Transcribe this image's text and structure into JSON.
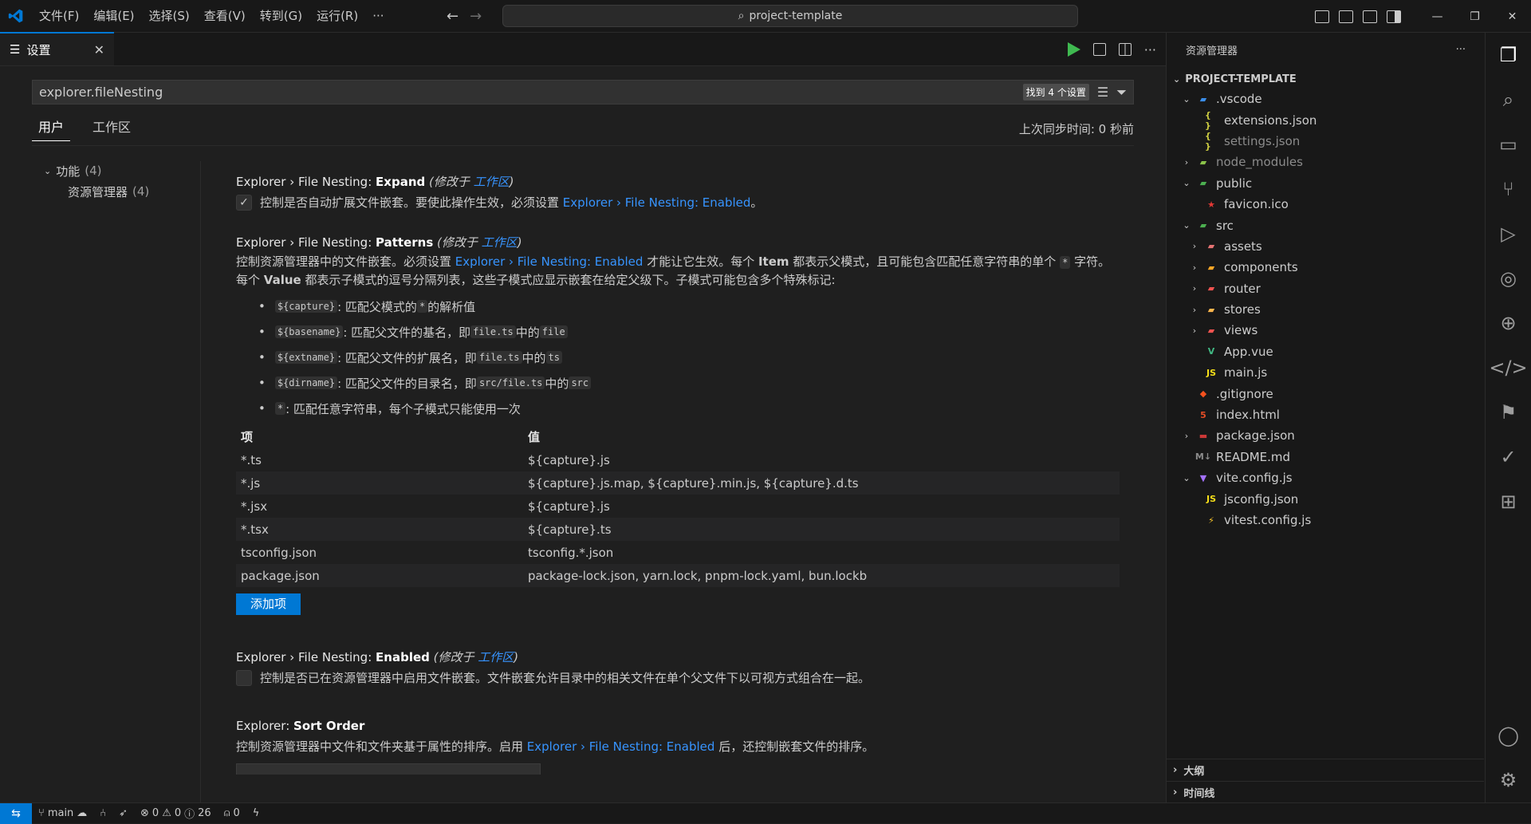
{
  "titlebar": {
    "menus": [
      "文件(F)",
      "编辑(E)",
      "选择(S)",
      "查看(V)",
      "转到(G)",
      "运行(R)",
      "···"
    ],
    "command_center": "project-template"
  },
  "editor": {
    "tab_label": "设置",
    "search_value": "explorer.fileNesting",
    "found_badge": "找到 4 个设置",
    "scope_tabs": [
      "用户",
      "工作区"
    ],
    "sync_time": "上次同步时间: 0 秒前",
    "toc": {
      "group": "功能",
      "group_count": "(4)",
      "item": "资源管理器",
      "item_count": "(4)"
    },
    "settings": {
      "expand": {
        "prefix": "Explorer › File Nesting: ",
        "name": "Expand",
        "modified": "(修改于 ",
        "workspace": "工作区",
        "close": ")",
        "desc_a": "控制是否自动扩展文件嵌套。要使此操作生效，必须设置 ",
        "desc_link": "Explorer › File Nesting: Enabled",
        "desc_b": "。"
      },
      "patterns": {
        "prefix": "Explorer › File Nesting: ",
        "name": "Patterns",
        "modified": "(修改于 ",
        "workspace": "工作区",
        "close": ")",
        "desc1_a": "控制资源管理器中的文件嵌套。必须设置 ",
        "desc1_link": "Explorer › File Nesting: Enabled",
        "desc1_b": " 才能让它生效。每个 ",
        "desc1_item": "Item",
        "desc1_c": " 都表示父模式，且可能包含匹配任意字符串的单个 ",
        "desc1_star": "*",
        "desc1_d": " 字符。",
        "desc2_a": "每个 ",
        "desc2_value": "Value",
        "desc2_b": " 都表示子模式的逗号分隔列表，这些子模式应显示嵌套在给定父级下。子模式可能包含多个特殊标记:",
        "bullets": [
          {
            "code": "${capture}",
            "text": ": 匹配父模式的 ",
            "code2": "*",
            "text2": " 的解析值",
            "code3": "",
            "text3": "",
            "code4": ""
          },
          {
            "code": "${basename}",
            "text": ": 匹配父文件的基名，即 ",
            "code2": "file.ts",
            "text2": " 中的 ",
            "code3": "file",
            "text3": "",
            "code4": ""
          },
          {
            "code": "${extname}",
            "text": ": 匹配父文件的扩展名，即 ",
            "code2": "file.ts",
            "text2": " 中的 ",
            "code3": "ts",
            "text3": "",
            "code4": ""
          },
          {
            "code": "${dirname}",
            "text": ": 匹配父文件的目录名，即 ",
            "code2": "src/file.ts",
            "text2": " 中的 ",
            "code3": "src",
            "text3": "",
            "code4": ""
          },
          {
            "code": "*",
            "text": ": 匹配任意字符串，每个子模式只能使用一次",
            "code2": "",
            "text2": "",
            "code3": "",
            "text3": "",
            "code4": ""
          }
        ],
        "table_headers": [
          "项",
          "值"
        ],
        "rows": [
          [
            "*.ts",
            "${capture}.js"
          ],
          [
            "*.js",
            "${capture}.js.map, ${capture}.min.js, ${capture}.d.ts"
          ],
          [
            "*.jsx",
            "${capture}.js"
          ],
          [
            "*.tsx",
            "${capture}.ts"
          ],
          [
            "tsconfig.json",
            "tsconfig.*.json"
          ],
          [
            "package.json",
            "package-lock.json, yarn.lock, pnpm-lock.yaml, bun.lockb"
          ]
        ],
        "add_button": "添加项"
      },
      "enabled": {
        "prefix": "Explorer › File Nesting: ",
        "name": "Enabled",
        "modified": "(修改于 ",
        "workspace": "工作区",
        "close": ")",
        "desc": "控制是否已在资源管理器中启用文件嵌套。文件嵌套允许目录中的相关文件在单个父文件下以可视方式组合在一起。"
      },
      "sort": {
        "prefix": "Explorer: ",
        "name": "Sort Order",
        "desc_a": "控制资源管理器中文件和文件夹基于属性的排序。启用 ",
        "desc_link": "Explorer › File Nesting: Enabled",
        "desc_b": " 后，还控制嵌套文件的排序。"
      }
    }
  },
  "explorer": {
    "title": "资源管理器",
    "project": "PROJECT-TEMPLATE",
    "tree": [
      {
        "label": ".vscode",
        "depth": 0,
        "chev": "⌄",
        "icon": "folder-vscode-icon",
        "glyph": "▰",
        "color": "#3b8eea"
      },
      {
        "label": "extensions.json",
        "depth": 1,
        "chev": "",
        "icon": "json-icon",
        "glyph": "{ }",
        "color": "#cbcb41"
      },
      {
        "label": "settings.json",
        "depth": 1,
        "chev": "",
        "icon": "json-icon",
        "glyph": "{ }",
        "color": "#cbcb41",
        "dim": true
      },
      {
        "label": "node_modules",
        "depth": 0,
        "chev": "›",
        "icon": "folder-node-icon",
        "glyph": "▰",
        "color": "#8bc34a",
        "dim": true
      },
      {
        "label": "public",
        "depth": 0,
        "chev": "⌄",
        "icon": "folder-public-icon",
        "glyph": "▰",
        "color": "#4caf50"
      },
      {
        "label": "favicon.ico",
        "depth": 1,
        "chev": "",
        "icon": "favicon-icon",
        "glyph": "★",
        "color": "#e53935"
      },
      {
        "label": "src",
        "depth": 0,
        "chev": "⌄",
        "icon": "folder-src-icon",
        "glyph": "▰",
        "color": "#4caf50"
      },
      {
        "label": "assets",
        "depth": 1,
        "chev": "›",
        "icon": "folder-assets-icon",
        "glyph": "▰",
        "color": "#e57373"
      },
      {
        "label": "components",
        "depth": 1,
        "chev": "›",
        "icon": "folder-components-icon",
        "glyph": "▰",
        "color": "#ffa726"
      },
      {
        "label": "router",
        "depth": 1,
        "chev": "›",
        "icon": "folder-router-icon",
        "glyph": "▰",
        "color": "#ef5350"
      },
      {
        "label": "stores",
        "depth": 1,
        "chev": "›",
        "icon": "folder-stores-icon",
        "glyph": "▰",
        "color": "#ffb74d"
      },
      {
        "label": "views",
        "depth": 1,
        "chev": "›",
        "icon": "folder-views-icon",
        "glyph": "▰",
        "color": "#ef5350"
      },
      {
        "label": "App.vue",
        "depth": 1,
        "chev": "",
        "icon": "vue-icon",
        "glyph": "V",
        "color": "#41b883"
      },
      {
        "label": "main.js",
        "depth": 1,
        "chev": "",
        "icon": "js-icon",
        "glyph": "JS",
        "color": "#f5de19"
      },
      {
        "label": ".gitignore",
        "depth": 0,
        "chev": "",
        "icon": "git-icon",
        "glyph": "◆",
        "color": "#f4511e"
      },
      {
        "label": "index.html",
        "depth": 0,
        "chev": "",
        "icon": "html-icon",
        "glyph": "5",
        "color": "#e44d26"
      },
      {
        "label": "package.json",
        "depth": 0,
        "chev": "›",
        "icon": "npm-icon",
        "glyph": "▬",
        "color": "#cb3837"
      },
      {
        "label": "README.md",
        "depth": 0,
        "chev": "",
        "icon": "markdown-icon",
        "glyph": "M↓",
        "color": "#8a8a8a"
      },
      {
        "label": "vite.config.js",
        "depth": 0,
        "chev": "⌄",
        "icon": "vite-icon",
        "glyph": "▼",
        "color": "#a472ff"
      },
      {
        "label": "jsconfig.json",
        "depth": 1,
        "chev": "",
        "icon": "js-icon",
        "glyph": "JS",
        "color": "#f5de19"
      },
      {
        "label": "vitest.config.js",
        "depth": 1,
        "chev": "",
        "icon": "vitest-icon",
        "glyph": "⚡",
        "color": "#fcc72b"
      }
    ],
    "outline": "大纲",
    "timeline": "时间线"
  },
  "statusbar": {
    "branch": "main",
    "errors": "0",
    "warnings": "0",
    "info": "26",
    "ports": "0"
  }
}
